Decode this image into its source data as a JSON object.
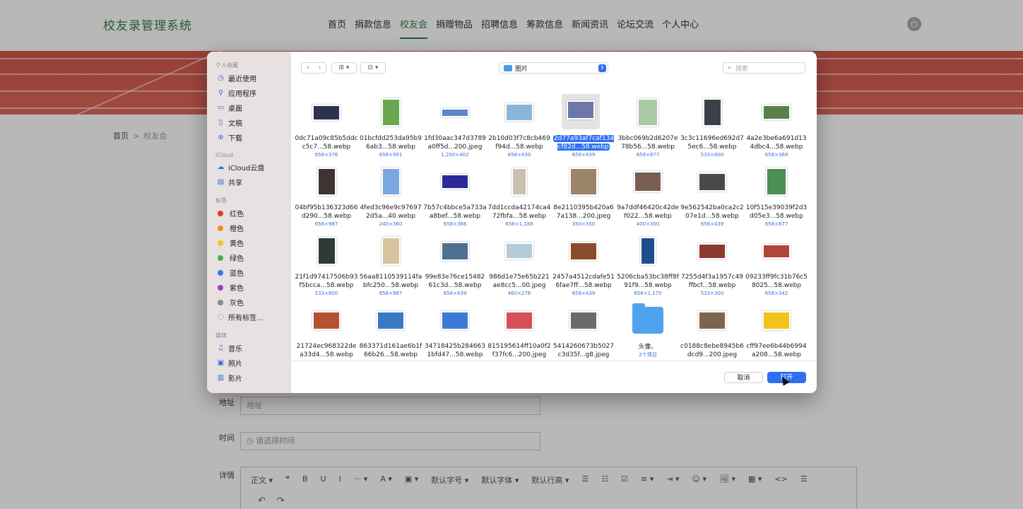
{
  "site": {
    "logo": "校友录管理系统",
    "nav": [
      "首页",
      "捐款信息",
      "校友会",
      "捐赠物品",
      "招聘信息",
      "筹款信息",
      "新闻资讯",
      "论坛交流",
      "个人中心"
    ],
    "nav_active_index": 2,
    "power_icon": "power-icon",
    "breadcrumb": {
      "home": "首页",
      "sep": ">",
      "current": "校友会"
    }
  },
  "form": {
    "address": {
      "label": "地址",
      "placeholder": "地址"
    },
    "time": {
      "label": "时间",
      "placeholder": "请选择时间",
      "icon": "clock-icon"
    },
    "detail": {
      "label": "详情"
    },
    "editor_toolbar": [
      "正文 ▾",
      "❝",
      "B",
      "U",
      "I",
      "··· ▾",
      "A ▾",
      "▣ ▾",
      "默认字号 ▾",
      "默认字体 ▾",
      "默认行高 ▾",
      "☰",
      "☷",
      "☑",
      "≡ ▾",
      "⇥ ▾",
      "☺ ▾",
      "🖼 ▾",
      "▦ ▾",
      "<>",
      "☰"
    ],
    "editor_undo": [
      "↶",
      "↷"
    ]
  },
  "dialog": {
    "sidebar": {
      "favorites_header": "个人收藏",
      "favorites": [
        {
          "label": "最近使用",
          "icon": "◷"
        },
        {
          "label": "应用程序",
          "icon": "⚲"
        },
        {
          "label": "桌面",
          "icon": "▭"
        },
        {
          "label": "文稿",
          "icon": "▯"
        },
        {
          "label": "下载",
          "icon": "⊕"
        }
      ],
      "icloud_header": "iCloud",
      "icloud": [
        {
          "label": "iCloud云盘",
          "icon": "☁"
        },
        {
          "label": "共享",
          "icon": "▤"
        }
      ],
      "tags_header": "标签",
      "tags": [
        {
          "label": "红色",
          "color": "#e5352f"
        },
        {
          "label": "橙色",
          "color": "#ef8b1c"
        },
        {
          "label": "黄色",
          "color": "#f5c518"
        },
        {
          "label": "绿色",
          "color": "#3bb54a"
        },
        {
          "label": "蓝色",
          "color": "#2f7bf0"
        },
        {
          "label": "紫色",
          "color": "#9a3fc4"
        },
        {
          "label": "灰色",
          "color": "#8a8a8a"
        }
      ],
      "all_tags": "所有标签...",
      "media_header": "媒体",
      "media": [
        {
          "label": "音乐",
          "icon": "♫"
        },
        {
          "label": "照片",
          "icon": "▣"
        },
        {
          "label": "影片",
          "icon": "▥"
        }
      ]
    },
    "toolbar": {
      "back": "‹",
      "forward": "›",
      "view_icon": "⊞ ▾",
      "group_icon": "⊟ ▾",
      "location": "图片",
      "location_stepper": "⇕",
      "search_icon": "⌕",
      "search_placeholder": "搜索"
    },
    "files": [
      {
        "name": "0dc71a09c85b5ddcc5c7...58.webp",
        "dims": "658×376",
        "color": "#2a3350"
      },
      {
        "name": "01bcfdd253da95b96ab3...58.webp",
        "dims": "658×991",
        "color": "#6aa84f"
      },
      {
        "name": "1fd30aac347d3789a0ff5d...200.jpeg",
        "dims": "1,200×402",
        "color": "#5d86c6"
      },
      {
        "name": "2b10d03f7c8cb469f94d...58.webp",
        "dims": "658×430",
        "color": "#8ab7d9"
      },
      {
        "name": "2d77a93af7caf134cf82d...58.webp",
        "dims": "658×439",
        "color": "#6c79a8",
        "selected": true
      },
      {
        "name": "3bbc069b2d6207e78b56...58.webp",
        "dims": "658×877",
        "color": "#a9c9a4"
      },
      {
        "name": "3c3c11696ed692d75ec6...58.webp",
        "dims": "533×800",
        "color": "#3b4048"
      },
      {
        "name": "4a2e3be6a691d134dbc4...58.webp",
        "dims": "658×369",
        "color": "#5b7f4a"
      },
      {
        "name": "04bf95b136323d66d290...58.webp",
        "dims": "658×987",
        "color": "#3e3432"
      },
      {
        "name": "4fed3c96e9c976972d5a...40.webp",
        "dims": "240×360",
        "color": "#7aa7e0"
      },
      {
        "name": "7b57c4bbce5a733aa8bef...58.webp",
        "dims": "658×366",
        "color": "#2c2a9b"
      },
      {
        "name": "7dd1ccda42174ca472fbfa...58.webp",
        "dims": "658×1,188",
        "color": "#c8c0b0"
      },
      {
        "name": "8e2110395b420a67a138...200.jpeg",
        "dims": "350×350",
        "color": "#9c8468"
      },
      {
        "name": "9a7ddf46420c42def022...58.webp",
        "dims": "400×300",
        "color": "#7a5e54"
      },
      {
        "name": "9e562542ba0ca2c207e1d...58.webp",
        "dims": "658×439",
        "color": "#4a4a4a"
      },
      {
        "name": "10f515e39039f2d3d05e3...58.webp",
        "dims": "658×877",
        "color": "#4d8e52"
      },
      {
        "name": "21f1d97417506b93f5bcca...58.webp",
        "dims": "533×800",
        "color": "#2f3a36"
      },
      {
        "name": "56aa8110539114fabfc250...58.webp",
        "dims": "658×987",
        "color": "#d8c2a0"
      },
      {
        "name": "99e83e76ce1548261c3d...58.webp",
        "dims": "658×439",
        "color": "#4f7191"
      },
      {
        "name": "986d1e75e65b221ae8cc5...00.jpeg",
        "dims": "460×276",
        "color": "#b3ccd8"
      },
      {
        "name": "2457a4512cdafe516fae7ff...58.webp",
        "dims": "658×439",
        "color": "#8a4b2a"
      },
      {
        "name": "5206cba53bc38ff8f91f9...58.webp",
        "dims": "658×1,170",
        "color": "#1e4f8a"
      },
      {
        "name": "7255d4f3a1957c49ffbcf...58.webp",
        "dims": "533×300",
        "color": "#8a3b30"
      },
      {
        "name": "09233ff9fc31b76c58025...58.webp",
        "dims": "658×342",
        "color": "#b04638"
      },
      {
        "name": "21724ec968322dea33d4...58.webp",
        "dims": "",
        "color": "#b5522f"
      },
      {
        "name": "863371d161ae6b1f66b26...58.webp",
        "dims": "",
        "color": "#3a78c2"
      },
      {
        "name": "34718425b2846631bfd47...58.webp",
        "dims": "",
        "color": "#3d7ad6"
      },
      {
        "name": "815195614ff10a0f2f37fc6...200.jpeg",
        "dims": "",
        "color": "#d54f58"
      },
      {
        "name": "5414260673b5027c3d35f...g8.jpeg",
        "dims": "",
        "color": "#6a6a6a"
      },
      {
        "name": "头像、",
        "dims": "2个项目",
        "folder": true
      },
      {
        "name": "c0188c8ebe8945b6dcd9...200.jpeg",
        "dims": "",
        "color": "#7a6550"
      },
      {
        "name": "cff97ee6b44b6994a208...58.webp",
        "dims": "",
        "color": "#f0c419"
      }
    ],
    "buttons": {
      "cancel": "取消",
      "open": "打开"
    }
  }
}
